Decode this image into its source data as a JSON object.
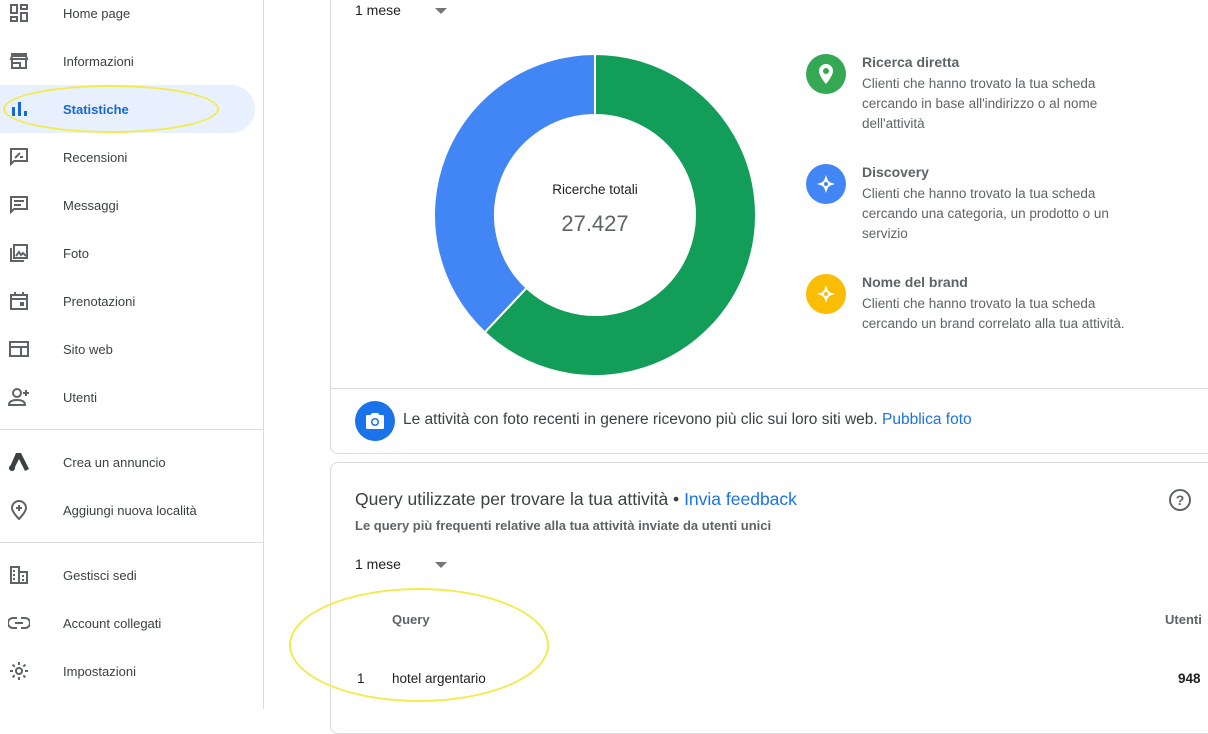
{
  "sidebar": {
    "items": [
      {
        "label": "Home page",
        "icon": "dashboard-icon"
      },
      {
        "label": "Informazioni",
        "icon": "storefront-icon"
      },
      {
        "label": "Statistiche",
        "icon": "bar-chart-icon"
      },
      {
        "label": "Recensioni",
        "icon": "rate-review-icon"
      },
      {
        "label": "Messaggi",
        "icon": "message-icon"
      },
      {
        "label": "Foto",
        "icon": "photo-library-icon"
      },
      {
        "label": "Prenotazioni",
        "icon": "calendar-icon"
      },
      {
        "label": "Sito web",
        "icon": "web-icon"
      },
      {
        "label": "Utenti",
        "icon": "add-user-icon"
      },
      {
        "label": "Crea un annuncio",
        "icon": "google-ads-icon"
      },
      {
        "label": "Aggiungi nuova località",
        "icon": "add-location-icon"
      },
      {
        "label": "Gestisci sedi",
        "icon": "domain-icon"
      },
      {
        "label": "Account collegati",
        "icon": "link-icon"
      },
      {
        "label": "Impostazioni",
        "icon": "settings-icon"
      }
    ],
    "active_index": 2
  },
  "search_card": {
    "period": "1 mese",
    "donut": {
      "center_label": "Ricerche totali",
      "center_value": "27.427"
    },
    "legend": [
      {
        "title": "Ricerca diretta",
        "desc": "Clienti che hanno trovato la tua scheda cercando in base all'indirizzo o al nome dell'attività",
        "color": "#34a853",
        "icon": "location-pin-icon"
      },
      {
        "title": "Discovery",
        "desc": "Clienti che hanno trovato la tua scheda cercando una categoria, un prodotto o un servizio",
        "color": "#4285f4",
        "icon": "compass-icon"
      },
      {
        "title": "Nome del brand",
        "desc": "Clienti che hanno trovato la tua scheda cercando un brand correlato alla tua attività.",
        "color": "#fbbc04",
        "icon": "compass-icon"
      }
    ],
    "tip_text": "Le attività con foto recenti in genere ricevono più clic sui loro siti web.",
    "tip_link": "Pubblica foto"
  },
  "chart_data": {
    "type": "pie",
    "categories": [
      "Ricerca diretta",
      "Discovery"
    ],
    "values": [
      62,
      38
    ],
    "unit": "%",
    "colors": [
      "#129d58",
      "#4285f4"
    ]
  },
  "query_card": {
    "title": "Query utilizzate per trovare la tua attività •",
    "feedback_link": "Invia feedback",
    "subtitle": "Le query più frequenti relative alla tua attività inviate da utenti unici",
    "period": "1 mese",
    "columns": {
      "query": "Query",
      "users": "Utenti"
    },
    "rows": [
      {
        "rank": "1",
        "query": "hotel argentario",
        "users": "948"
      }
    ]
  },
  "colors": {
    "accent": "#1a73e8",
    "active_bg": "#e8f0fe",
    "highlight": "#f0ec4e"
  }
}
